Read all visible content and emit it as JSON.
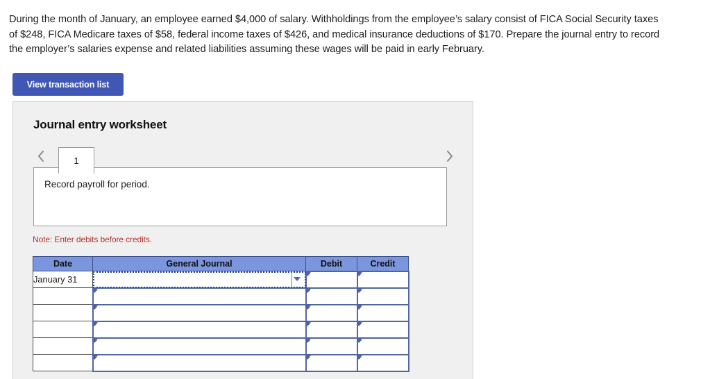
{
  "problem": {
    "statement": "During the month of January, an employee earned $4,000 of salary. Withholdings from the employee’s salary consist of FICA Social Security taxes of $248, FICA Medicare taxes of $58, federal income taxes of $426, and medical insurance deductions of $170. Prepare the journal entry to record the employer’s salaries expense and related liabilities assuming these wages will be paid in early February."
  },
  "toolbar": {
    "view_transaction_list_label": "View transaction list"
  },
  "worksheet": {
    "title": "Journal entry worksheet",
    "prev_icon": "chevron-left-icon",
    "next_icon": "chevron-right-icon",
    "tabs": [
      {
        "label": "1",
        "active": true
      }
    ],
    "entry_description": "Record payroll for period.",
    "note": "Note: Enter debits before credits."
  },
  "journal_table": {
    "columns": [
      "Date",
      "General Journal",
      "Debit",
      "Credit"
    ],
    "rows": [
      {
        "date": "January 31",
        "general_journal": "",
        "debit": "",
        "credit": "",
        "gj_focused": true
      },
      {
        "date": "",
        "general_journal": "",
        "debit": "",
        "credit": "",
        "gj_focused": false
      },
      {
        "date": "",
        "general_journal": "",
        "debit": "",
        "credit": "",
        "gj_focused": false
      },
      {
        "date": "",
        "general_journal": "",
        "debit": "",
        "credit": "",
        "gj_focused": false
      },
      {
        "date": "",
        "general_journal": "",
        "debit": "",
        "credit": "",
        "gj_focused": false
      },
      {
        "date": "",
        "general_journal": "",
        "debit": "",
        "credit": "",
        "gj_focused": false
      }
    ]
  },
  "colors": {
    "button_blue": "#4157b5",
    "table_header_blue": "#7b96dd",
    "cell_border_blue": "#4f659f",
    "note_red": "#b5332a",
    "panel_gray": "#f0f0f0"
  }
}
